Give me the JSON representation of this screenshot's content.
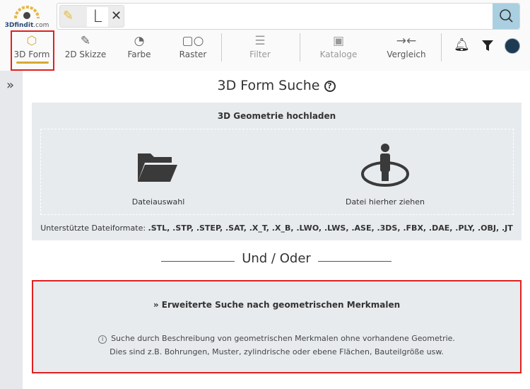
{
  "logo": {
    "brand": "3Dfindit",
    "suffix": ".com"
  },
  "search": {
    "sketch_char": "L",
    "value": ""
  },
  "toolbar": [
    {
      "label": "3D Form",
      "icon": "cube-icon",
      "active": true
    },
    {
      "label": "2D Skizze",
      "icon": "pencil-icon"
    },
    {
      "label": "Farbe",
      "icon": "palette-icon"
    },
    {
      "label": "Raster",
      "icon": "shapes-icon"
    },
    {
      "label": "Filter",
      "icon": "sliders-icon"
    },
    {
      "label": "Kataloge",
      "icon": "catalog-icon"
    },
    {
      "label": "Vergleich",
      "icon": "compare-icon"
    }
  ],
  "main": {
    "title": "3D Form Suche",
    "upload_title": "3D Geometrie hochladen",
    "file_select": "Dateiauswahl",
    "drag_here": "Datei hierher ziehen",
    "formats_label": "Unterstützte Dateiformate:",
    "formats": ".STL, .STP, .STEP, .SAT, .X_T, .X_B, .LWO, .LWS, .ASE, .3DS, .FBX, .DAE, .PLY, .OBJ, .JT",
    "or": "Und / Oder",
    "advanced_title": "Erweiterte Suche nach geometrischen Merkmalen",
    "advanced_desc1": "Suche durch Beschreibung von geometrischen Merkmalen ohne vorhandene Geometrie.",
    "advanced_desc2": "Dies sind z.B. Bohrungen, Muster, zylindrische oder ebene Flächen, Bauteilgröße usw."
  }
}
